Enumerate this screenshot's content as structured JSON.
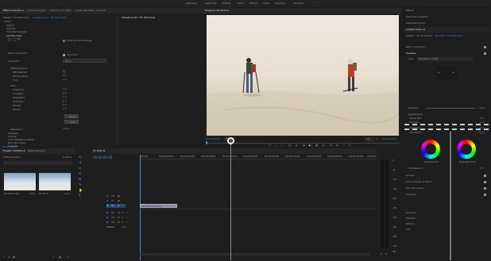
{
  "workspaces": {
    "items": [
      "Learning",
      "Assembly",
      "Editing",
      "Color",
      "Effects",
      "Audio",
      "Graphics",
      "Libraries"
    ],
    "active_index": 3,
    "more_label": "»"
  },
  "left_panel": {
    "tabs": [
      "Effect Controls ≡",
      "Lumetri Scopes",
      "Source: (no clips)",
      "Audio Clip Mixer: 01 Shot"
    ],
    "header": {
      "master": "Master * 01 Shot.mp4",
      "clip": "Sequence 01 * 01 Shot.mp4"
    },
    "video_label": "Video",
    "effects": [
      "Motion",
      "Opacity",
      "Time Remapping",
      "Lumetri Color"
    ],
    "mask_icons": [
      "○",
      "□",
      "✎"
    ],
    "high_dynamic_range_label": "High Dynamic Range",
    "basic_correction": "Basic Correction",
    "input_lut_label": "Input LUT",
    "input_lut_value": "None",
    "white_balance": "White Balance",
    "wb_items": [
      "WB Selector",
      "Temperature",
      "Tint"
    ],
    "tone_label": "Tone",
    "tone_items": [
      "Exposure",
      "Contrast",
      "Highlights",
      "Shadows",
      "Whites",
      "Blacks"
    ],
    "values": [
      "0.0",
      "0.0",
      "0.0",
      "0.0",
      "0.0",
      "0.0",
      "0.0",
      "0.0"
    ],
    "reset_button": "Reset",
    "auto_button": "Auto",
    "saturation_label": "Saturation",
    "saturation_value": "100.0",
    "bottom_items": [
      "Creative",
      "Curves",
      "Color Wheels & Match",
      "HSL Secondary",
      "Vignette"
    ],
    "timecode": "00:00:00:00"
  },
  "program": {
    "title": "Program: 01 Shot ≡",
    "timecode": "00:00:00:00",
    "fit": "Fit",
    "resolution": "1/2",
    "duration": "00:00:09:23",
    "controls": [
      "▾",
      "{",
      "}",
      "|◂",
      "◂|",
      "◀",
      "▶",
      "|▶",
      "▸|",
      "⊞",
      "⊟",
      "⬚",
      "✎"
    ]
  },
  "project": {
    "tabs": [
      "Project: Untitled ≡",
      "Media Browser"
    ],
    "path": "Untitled.prproj",
    "item_count": "2 Items",
    "clips": [
      {
        "name": "01 Shot.mp4",
        "duration": "9:23"
      },
      {
        "name": "01 Shot",
        "duration": "9:23"
      }
    ]
  },
  "timeline": {
    "tab": "01 Shot ≡",
    "timecode": "00:00:00:00",
    "ruler": [
      "00:00",
      "00:00:05:00",
      "00:00:10:00",
      "00:00:15:00",
      "00:00:20:00",
      "00:00:25:00",
      "00:00:30:00",
      "00:00:35:00",
      "00:00:40:00",
      "00:00:45:00",
      "00:00:50:00",
      "00:00:55:00"
    ],
    "video_tracks": [
      "V3",
      "V2",
      "V1"
    ],
    "audio_tracks": [
      "A1",
      "A2",
      "A3"
    ],
    "master_label": "Master",
    "master_value": "0.0",
    "clip_label": "01 Shot.mp4 [V]"
  },
  "meter": {
    "scale": [
      "0",
      "-6",
      "-12",
      "-18",
      "-24",
      "-30",
      "-36",
      "-42",
      "-48",
      "-54"
    ],
    "unit": "dB",
    "solo": [
      "S",
      "S"
    ]
  },
  "lumetri": {
    "sections": [
      "Effects",
      "Essential Graphics",
      "Essential Sound"
    ],
    "title": "Lumetri Color ≡",
    "source": "Master * 01 Shot.mp4",
    "clip": "01 Shot * 01 Shot.mp4",
    "basic_correction": "Basic Correction",
    "creative": "Creative",
    "look_label": "Look",
    "look_value": "Fuji Eterna 250D",
    "intensity_label": "Intensity",
    "intensity_value": "100.0",
    "adjustments_label": "Adjustments",
    "faded_film_label": "Faded Film",
    "faded_film_value": "0.0",
    "sharpen_label": "Sharpen",
    "sharpen_value": "0.0",
    "vibrance_label": "Vibrance",
    "vibrance_value": "0.0",
    "saturation_label": "Saturation",
    "saturation_value": "100.0",
    "wheel_labels": [
      "Shadow Tint",
      "Highlight Tint"
    ],
    "tint_balance_label": "Tint Balance",
    "tint_balance_value": "0.0",
    "more": [
      "Curves",
      "Color Wheels & Match",
      "HSL Secondary",
      "Vignette"
    ],
    "bottom_items": [
      "Libraries",
      "Markers",
      "History",
      "Info"
    ]
  },
  "colors": {
    "accent": "#3e8ae4",
    "selected_track": "#2a6bb5",
    "snow": "#e8e0d2"
  }
}
